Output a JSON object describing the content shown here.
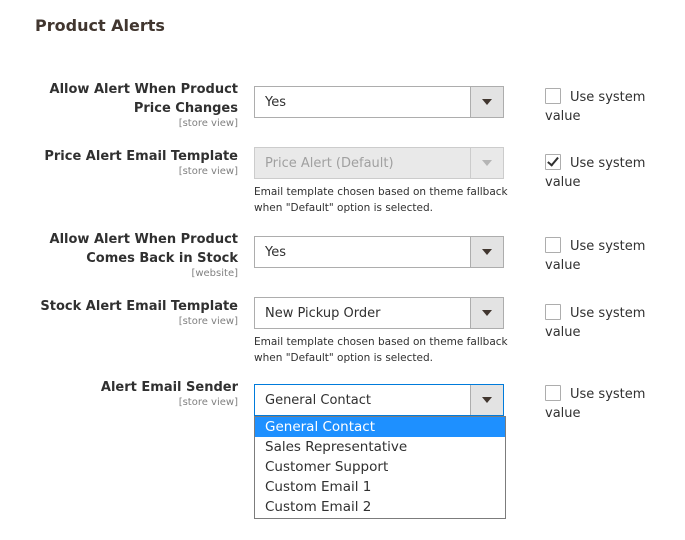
{
  "section": {
    "title": "Product Alerts"
  },
  "use_system_label": "Use system value",
  "fields": [
    {
      "label": "Allow Alert When Product Price Changes",
      "scope": "[store view]",
      "value": "Yes",
      "use_system": false
    },
    {
      "label": "Price Alert Email Template",
      "scope": "[store view]",
      "value": "Price Alert (Default)",
      "use_system": true,
      "note": "Email template chosen based on theme fallback when \"Default\" option is selected."
    },
    {
      "label": "Allow Alert When Product Comes Back in Stock",
      "scope": "[website]",
      "value": "Yes",
      "use_system": false
    },
    {
      "label": "Stock Alert Email Template",
      "scope": "[store view]",
      "value": "New Pickup Order",
      "use_system": false,
      "note": "Email template chosen based on theme fallback when \"Default\" option is selected."
    },
    {
      "label": "Alert Email Sender",
      "scope": "[store view]",
      "value": "General Contact",
      "use_system": false
    }
  ],
  "sender_options": [
    "General Contact",
    "Sales Representative",
    "Customer Support",
    "Custom Email 1",
    "Custom Email 2"
  ],
  "sender_selected": "General Contact",
  "colors": {
    "highlight": "#1e90ff",
    "title": "#41362f",
    "border": "#adadad"
  },
  "icons": {
    "select_arrow": "chevron-down-icon",
    "check": "checkmark-icon"
  }
}
